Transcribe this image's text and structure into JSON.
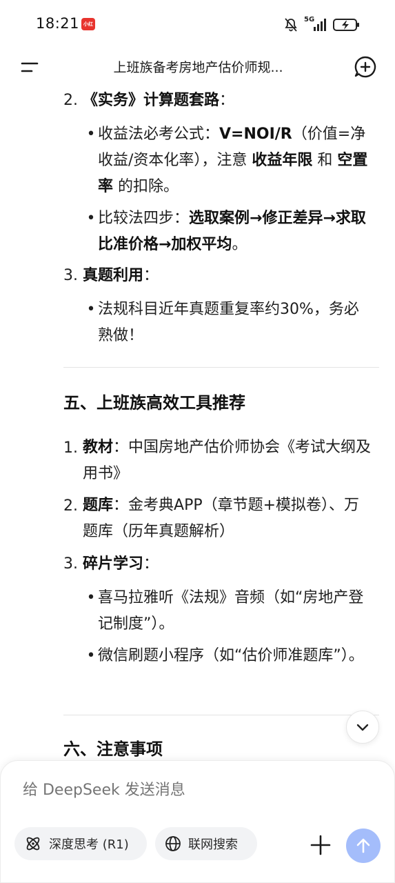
{
  "status": {
    "time": "18:21",
    "app_badge": "小红书",
    "network": "5G"
  },
  "header": {
    "title": "上班族备考房地产估价师规..."
  },
  "content": {
    "item2": {
      "num": "2.",
      "title": "《实务》计算题套路",
      "suffix": "："
    },
    "b1": {
      "p1": "收益法必考公式：",
      "formula": "V=NOI/R",
      "p2": "（价值=净收益/资本化率），注意 ",
      "b1": "收益年限",
      "p3": " 和 ",
      "b2": "空置率",
      "p4": " 的扣除。"
    },
    "b2": {
      "p1": "比较法四步：",
      "steps": "选取案例→修正差异→求取比准价格→加权平均",
      "p2": "。"
    },
    "item3": {
      "num": "3.",
      "title": "真题利用",
      "suffix": "："
    },
    "b3": {
      "text": "法规科目近年真题重复率约30%，务必熟做！"
    },
    "section5": "五、上班族高效工具推荐",
    "tools": [
      {
        "num": "1.",
        "title": "教材",
        "text": "：中国房地产估价师协会《考试大纲及用书》"
      },
      {
        "num": "2.",
        "title": "题库",
        "text": "：金考典APP（章节题+模拟卷）、万题库（历年真题解析）"
      },
      {
        "num": "3.",
        "title": "碎片学习",
        "text": "："
      }
    ],
    "b4": "喜马拉雅听《法规》音频（如“房地产登记制度”）。",
    "b5": "微信刷题小程序（如“估价师准题库”）。",
    "section6": "六、注意事项"
  },
  "composer": {
    "placeholder": "给 DeepSeek 发送消息",
    "deep_think_label": "深度思考 (R1)",
    "web_search_label": "联网搜索"
  },
  "colors": {
    "send_button": "#a4bdfb",
    "pill_bg": "#f2f3f5",
    "badge_red": "#e8342e"
  }
}
